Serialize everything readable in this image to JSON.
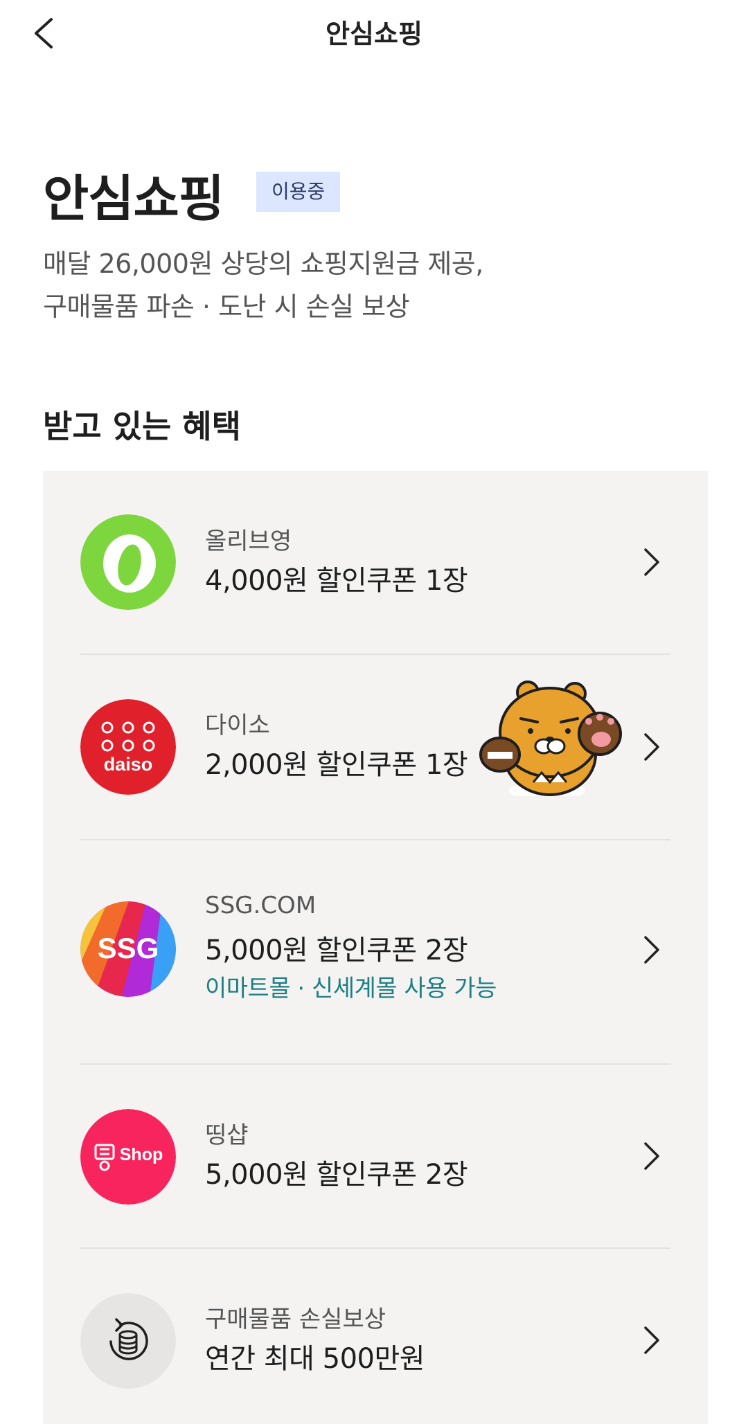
{
  "header": {
    "title": "안심쇼핑",
    "back_icon": "chevron-left-icon"
  },
  "hero": {
    "title": "안심쇼핑",
    "status_badge": "이용중",
    "description_line1": "매달 26,000원 상당의 쇼핑지원금 제공,",
    "description_line2": "구매물품 파손 · 도난 시 손실 보상"
  },
  "benefits": {
    "section_title": "받고 있는 혜택",
    "items": [
      {
        "brand": "올리브영",
        "detail": "4,000원 할인쿠폰 1장",
        "icon": "oliveyoung-logo-icon"
      },
      {
        "brand": "다이소",
        "detail": "2,000원 할인쿠폰 1장",
        "icon": "daiso-logo-icon",
        "logo_text": "daiso"
      },
      {
        "brand": "SSG.COM",
        "detail": "5,000원 할인쿠폰 2장",
        "note": "이마트몰 · 신세계몰 사용 가능",
        "icon": "ssg-logo-icon",
        "logo_text": "SSG"
      },
      {
        "brand": "띵샵",
        "detail": "5,000원 할인쿠폰 2장",
        "icon": "ttingshop-logo-icon",
        "logo_text": "Shop"
      },
      {
        "brand": "구매물품 손실보상",
        "detail": "연간 최대 500만원",
        "icon": "coin-refresh-icon"
      }
    ]
  },
  "colors": {
    "badge_bg": "#dde6ff",
    "panel_bg": "#f4f3f2",
    "note_teal": "#1d7f83",
    "oliveyoung_green": "#7ed63f",
    "daiso_red": "#e0202a",
    "ttingshop_pink": "#f7245e"
  }
}
